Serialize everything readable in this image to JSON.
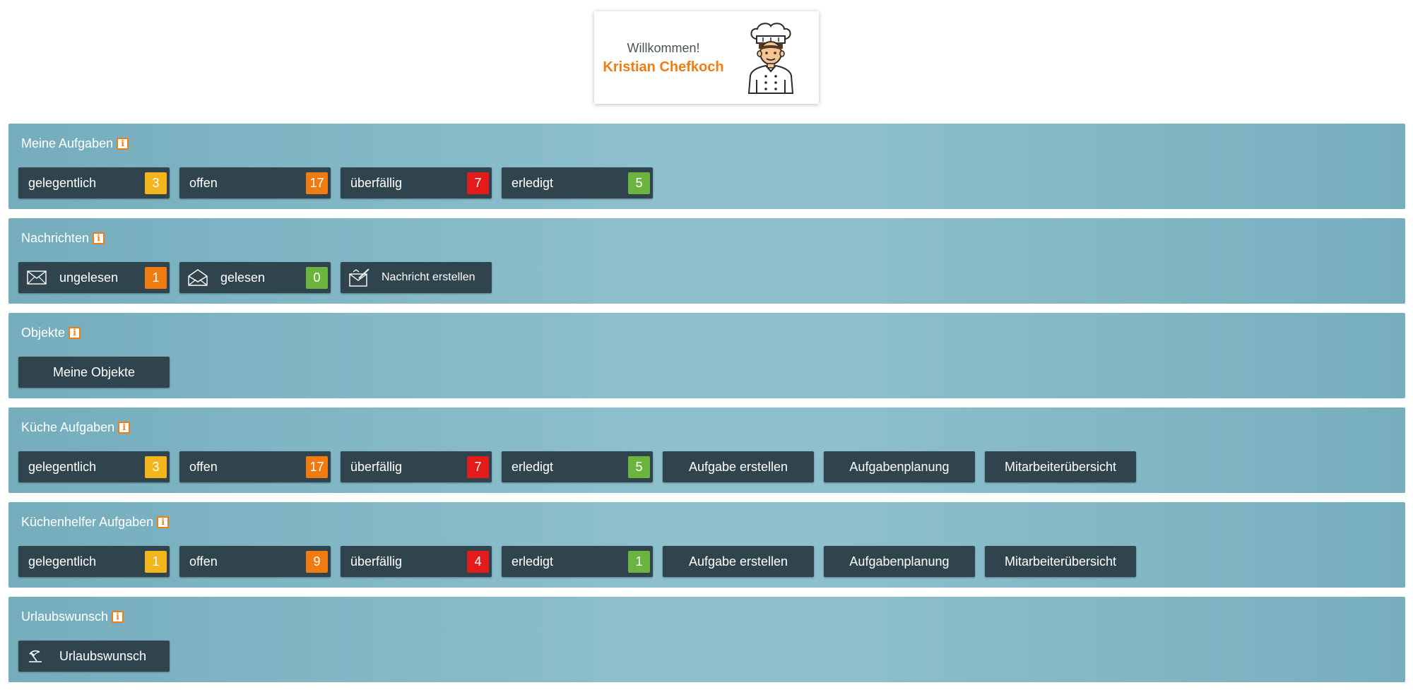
{
  "welcome": {
    "greeting": "Willkommen!",
    "name": "Kristian Chefkoch"
  },
  "panels": [
    {
      "title": "Meine Aufgaben",
      "buttons": [
        {
          "label": "gelegentlich",
          "count": "3",
          "color": "#f2b51c"
        },
        {
          "label": "offen",
          "count": "17",
          "color": "#ef7b11"
        },
        {
          "label": "überfällig",
          "count": "7",
          "color": "#e41b1b"
        },
        {
          "label": "erledigt",
          "count": "5",
          "color": "#6bb43f"
        }
      ]
    },
    {
      "title": "Nachrichten",
      "buttons": [
        {
          "label": "ungelesen",
          "count": "1",
          "color": "#ef7b11",
          "icon": "envelope-closed-icon"
        },
        {
          "label": "gelesen",
          "count": "0",
          "color": "#6bb43f",
          "icon": "envelope-open-icon"
        },
        {
          "label": "Nachricht erstellen",
          "icon": "envelope-write-icon"
        }
      ]
    },
    {
      "title": "Objekte",
      "buttons": [
        {
          "label": "Meine Objekte"
        }
      ]
    },
    {
      "title": "Küche Aufgaben",
      "buttons": [
        {
          "label": "gelegentlich",
          "count": "3",
          "color": "#f2b51c"
        },
        {
          "label": "offen",
          "count": "17",
          "color": "#ef7b11"
        },
        {
          "label": "überfällig",
          "count": "7",
          "color": "#e41b1b"
        },
        {
          "label": "erledigt",
          "count": "5",
          "color": "#6bb43f"
        },
        {
          "label": "Aufgabe erstellen"
        },
        {
          "label": "Aufgabenplanung"
        },
        {
          "label": "Mitarbeiterübersicht"
        }
      ]
    },
    {
      "title": "Küchenhelfer Aufgaben",
      "buttons": [
        {
          "label": "gelegentlich",
          "count": "1",
          "color": "#f2b51c"
        },
        {
          "label": "offen",
          "count": "9",
          "color": "#ef7b11"
        },
        {
          "label": "überfällig",
          "count": "4",
          "color": "#e41b1b"
        },
        {
          "label": "erledigt",
          "count": "1",
          "color": "#6bb43f"
        },
        {
          "label": "Aufgabe erstellen"
        },
        {
          "label": "Aufgabenplanung"
        },
        {
          "label": "Mitarbeiterübersicht"
        }
      ]
    },
    {
      "title": "Urlaubswunsch",
      "buttons": [
        {
          "label": "Urlaubswunsch",
          "icon": "beach-umbrella-icon"
        }
      ]
    }
  ]
}
